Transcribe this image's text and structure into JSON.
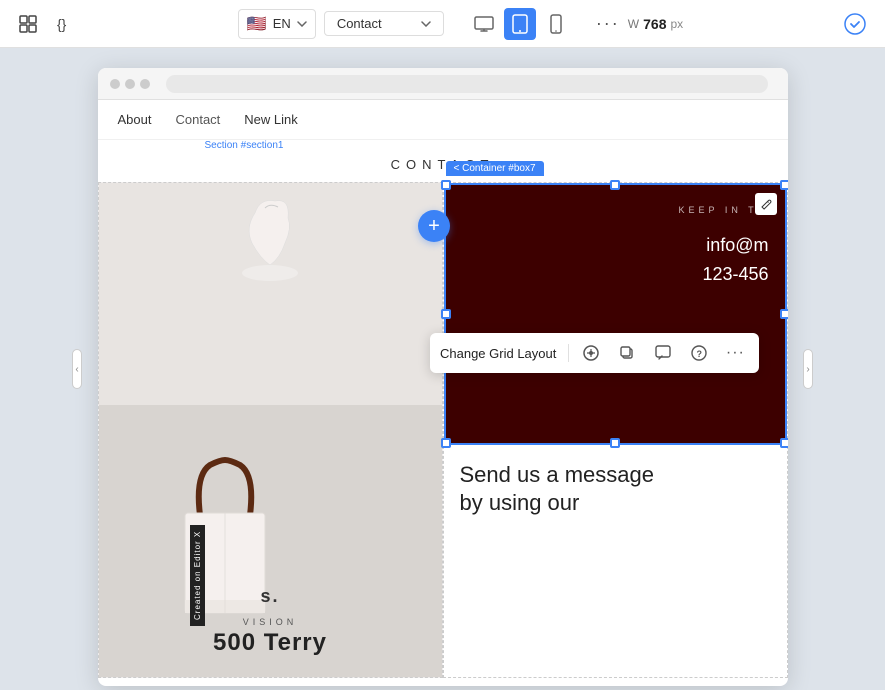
{
  "toolbar": {
    "lang": "EN",
    "flag": "🇺🇸",
    "page": "Contact",
    "width_label": "W",
    "width_value": "768",
    "width_unit": "px",
    "more_dots": "···"
  },
  "devices": [
    {
      "id": "desktop",
      "icon": "🖥",
      "active": false
    },
    {
      "id": "tablet-landscape",
      "icon": "⬛",
      "active": true
    },
    {
      "id": "mobile",
      "icon": "📱",
      "active": false
    }
  ],
  "browser": {
    "url_placeholder": ""
  },
  "site_nav": {
    "links": [
      "About",
      "Contact",
      "New Link"
    ]
  },
  "section_breadcrumb": "Section #section1",
  "page_title": "CONTACT",
  "grid": {
    "left": {
      "vision_label": "VISION",
      "vision_number": "500 Terry"
    },
    "right": {
      "container_label": "< Container #box7",
      "keep_in_touch": "KEEP IN TO",
      "email": "info@m",
      "phone": "123-456",
      "message_title": "Send us a message\nby using our"
    }
  },
  "floating_toolbar": {
    "label": "Change Grid Layout",
    "buttons": [
      {
        "id": "grid-icon",
        "symbol": "◈"
      },
      {
        "id": "copy-icon",
        "symbol": "⧉"
      },
      {
        "id": "comment-icon",
        "symbol": "💬"
      },
      {
        "id": "help-icon",
        "symbol": "?"
      },
      {
        "id": "more-icon",
        "symbol": "···"
      }
    ]
  },
  "plus_button": "+",
  "editor_label": "Created on Editor X"
}
